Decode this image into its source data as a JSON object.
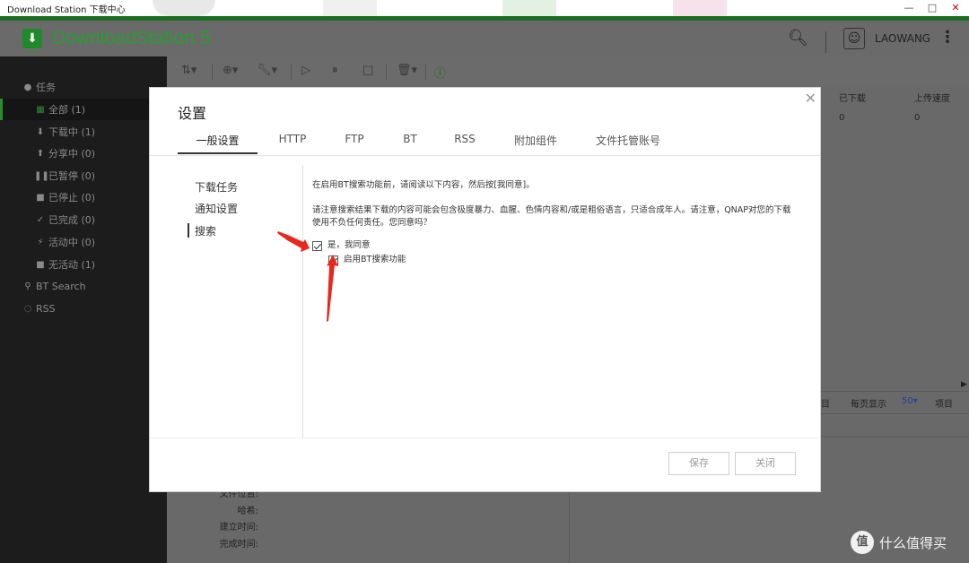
{
  "window": {
    "title": "Download Station 下载中心"
  },
  "header": {
    "app_name": "DownloadStation 5",
    "user": "LAOWANG"
  },
  "sidebar": {
    "section_tasks": "任务",
    "items": [
      {
        "label": "全部 (1)"
      },
      {
        "label": "下载中 (1)"
      },
      {
        "label": "分享中 (0)"
      },
      {
        "label": "已暂停 (0)"
      },
      {
        "label": "已停止 (0)"
      },
      {
        "label": "已完成 (0)"
      },
      {
        "label": "活动中 (0)"
      },
      {
        "label": "无活动 (1)"
      }
    ],
    "bt_search": "BT Search",
    "rss": "RSS"
  },
  "table": {
    "columns": [
      "已下载",
      "上传速度"
    ],
    "row": [
      "0",
      "0"
    ]
  },
  "pagination": {
    "pre": "目",
    "per_page": "每页显示",
    "value": "50▾",
    "suffix": "项目"
  },
  "details": {
    "labels": [
      "文件位置:",
      "哈希:",
      "建立时间:",
      "完成时间:"
    ]
  },
  "dialog": {
    "title": "设置",
    "tabs": [
      "一般设置",
      "HTTP",
      "FTP",
      "BT",
      "RSS",
      "附加组件",
      "文件托管账号"
    ],
    "left_menu": [
      "下载任务",
      "通知设置",
      "搜索"
    ],
    "notice": "在启用BT搜索功能前，请阅读以下内容，然后按[我同意]。",
    "warning": "请注意搜索结果下载的内容可能会包含极度暴力、血腥、色情内容和/或是粗俗语言，只适合成年人。请注意，QNAP对您的下载使用不负任何责任。您同意吗？",
    "agree_label": "是，我同意",
    "enable_bt_label": "启用BT搜索功能",
    "save": "保存",
    "close": "关闭"
  },
  "watermark": {
    "badge": "值",
    "text": "什么值得买"
  },
  "colors": {
    "accent_green": "#2c9a33",
    "annotation_red": "#e8281e"
  }
}
